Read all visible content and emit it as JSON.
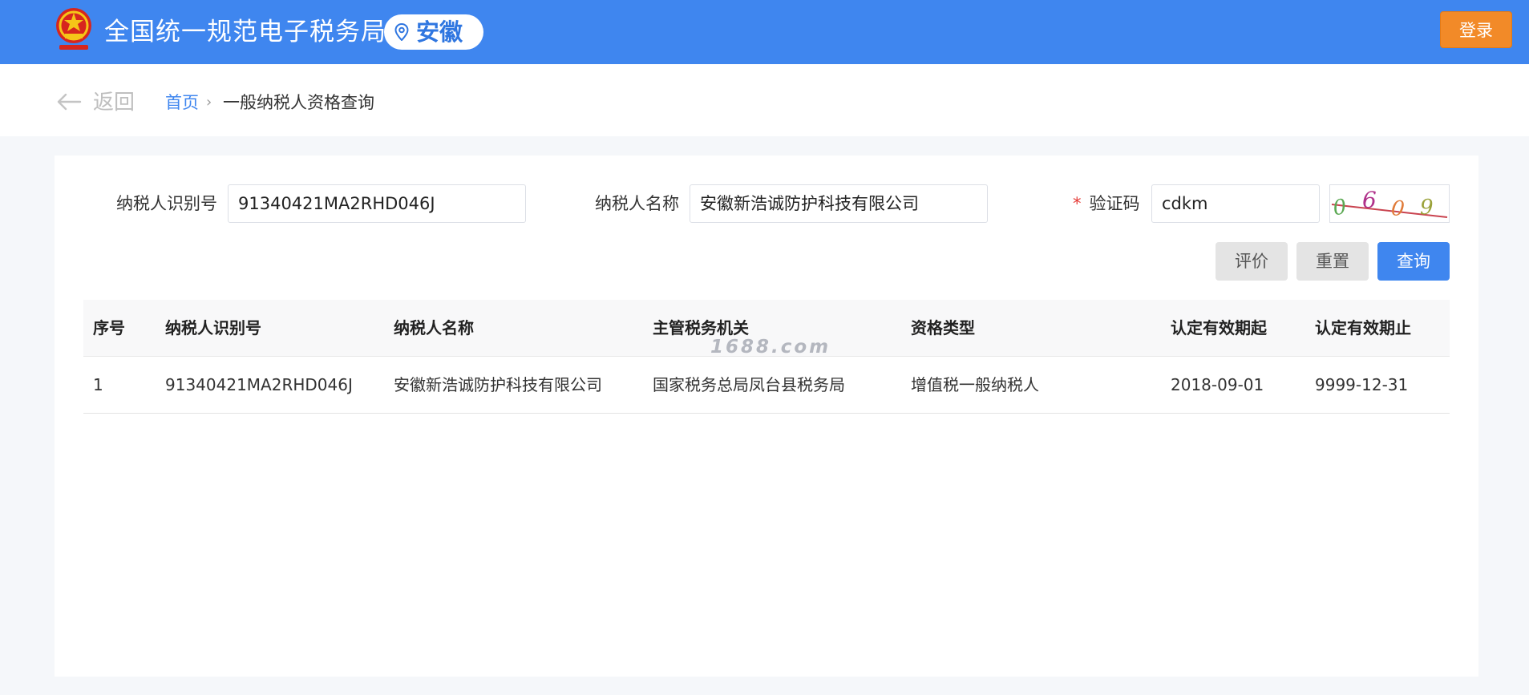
{
  "header": {
    "site_title": "全国统一规范电子税务局",
    "region": "安徽",
    "login_label": "登录",
    "colors": {
      "bar": "#3f86ef",
      "login": "#f28a28"
    }
  },
  "breadcrumb": {
    "back_label": "返回",
    "home": "首页",
    "separator": "›",
    "current": "一般纳税人资格查询"
  },
  "form": {
    "taxpayer_id": {
      "label": "纳税人识别号",
      "value": "91340421MA2RHD046J"
    },
    "taxpayer_name": {
      "label": "纳税人名称",
      "value": "安徽新浩诚防护科技有限公司"
    },
    "captcha": {
      "required_mark": "*",
      "label": "验证码",
      "value": "cdkm",
      "image_text": "0609"
    }
  },
  "buttons": {
    "evaluate": "评价",
    "reset": "重置",
    "search": "查询"
  },
  "table": {
    "headers": {
      "seq": "序号",
      "id": "纳税人识别号",
      "name": "纳税人名称",
      "authority": "主管税务机关",
      "type": "资格类型",
      "start": "认定有效期起",
      "end": "认定有效期止"
    },
    "rows": [
      {
        "seq": "1",
        "id": "91340421MA2RHD046J",
        "name": "安徽新浩诚防护科技有限公司",
        "authority": "国家税务总局凤台县税务局",
        "type": "增值税一般纳税人",
        "start": "2018-09-01",
        "end": "9999-12-31"
      }
    ]
  },
  "watermark": "1688.com",
  "icons": {
    "emblem": "national-emblem-icon",
    "pin": "location-pin-icon",
    "back": "arrow-left-icon"
  }
}
